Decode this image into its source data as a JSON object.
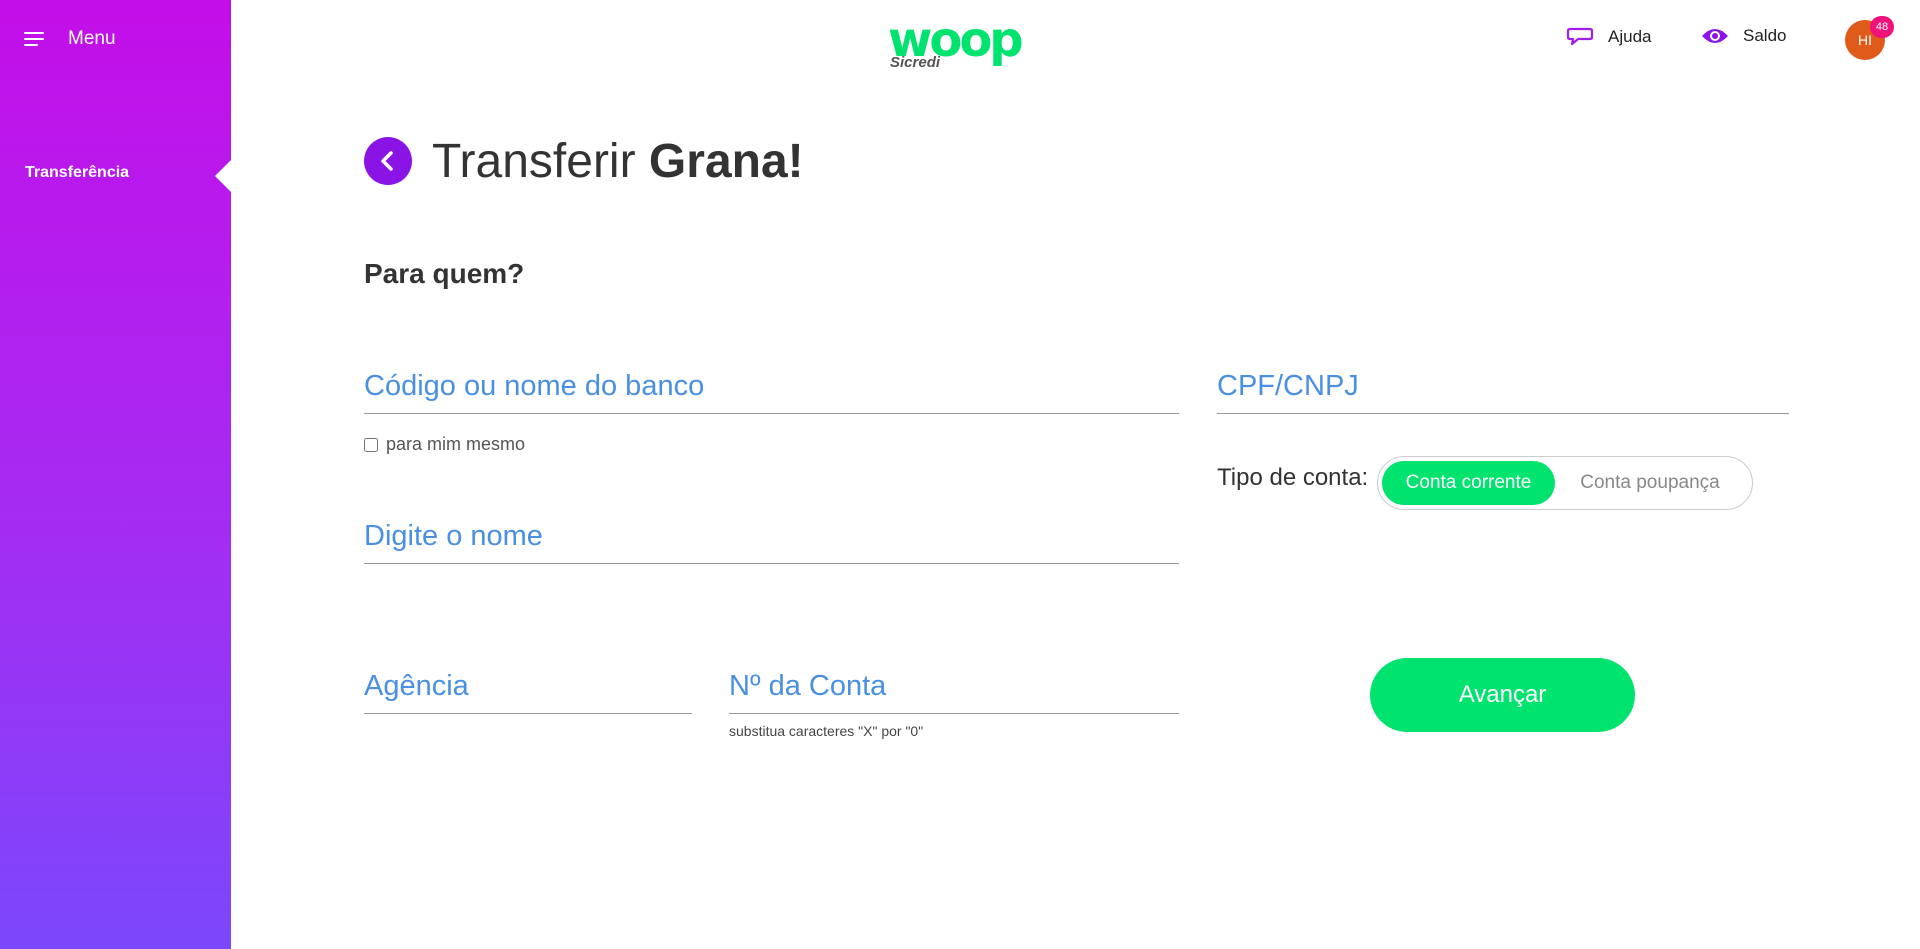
{
  "sidebar": {
    "menu_label": "Menu",
    "items": [
      {
        "label": "Transferência"
      }
    ]
  },
  "header": {
    "logo_text": "woop",
    "logo_sub": "Sicredi",
    "help_label": "Ajuda",
    "balance_label": "Saldo",
    "avatar_initials": "HI",
    "notification_count": "48"
  },
  "page": {
    "title_regular": "Transferir ",
    "title_bold": "Grana!",
    "subtitle": "Para quem?"
  },
  "form": {
    "bank_placeholder": "Código ou nome do banco",
    "cpf_placeholder": "CPF/CNPJ",
    "self_label": "para mim mesmo",
    "name_placeholder": "Digite o nome",
    "agency_placeholder": "Agência",
    "account_placeholder": "Nº da Conta",
    "account_hint": "substitua caracteres \"X\" por \"0\"",
    "account_type_label": "Tipo de conta:",
    "account_type_options": [
      "Conta corrente",
      "Conta poupança"
    ],
    "account_type_selected": "Conta corrente",
    "submit_label": "Avançar"
  },
  "colors": {
    "sidebar_top": "#c30ee8",
    "sidebar_bottom": "#7b47fb",
    "accent_green": "#00e36f",
    "accent_purple": "#8a14e6",
    "placeholder_blue": "#4a90e2"
  }
}
